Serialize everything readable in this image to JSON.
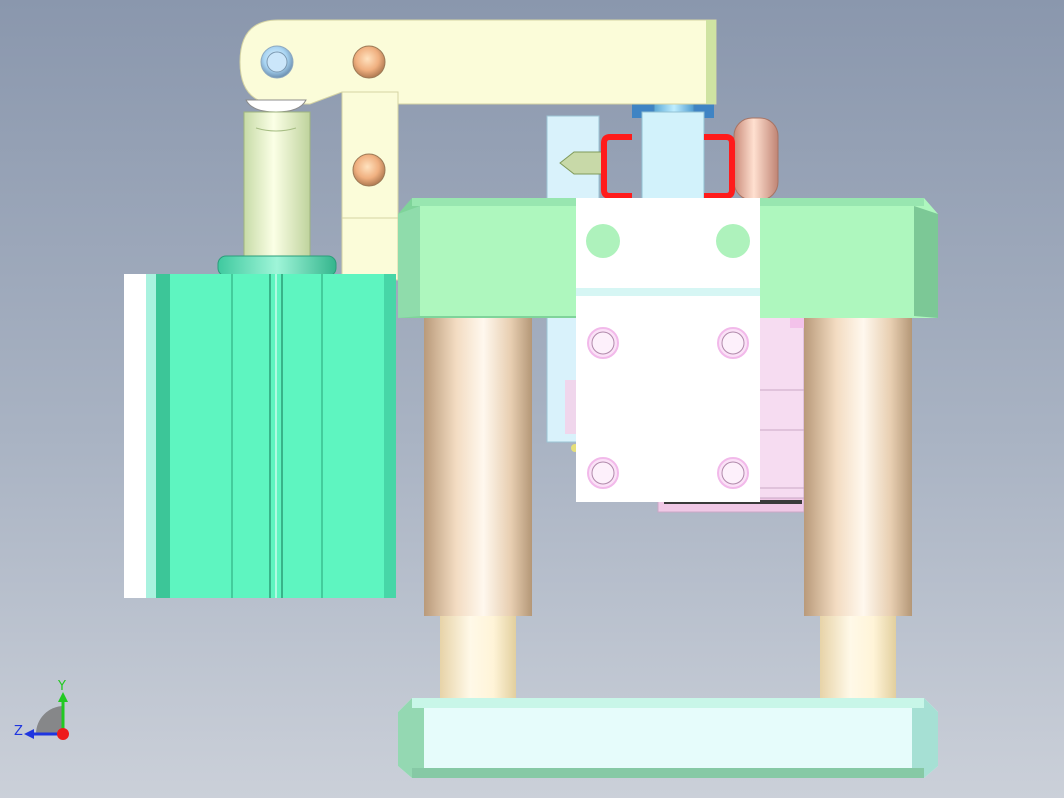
{
  "viewport": {
    "background_top": "#8a97ad",
    "background_bottom": "#cbd0d9"
  },
  "model": {
    "parts": [
      "top-clamp-arm",
      "vertical-link",
      "cylinder-rod",
      "pneumatic-cylinder",
      "top-plate",
      "guide-pillars",
      "center-block",
      "side-block",
      "locating-pin",
      "clamp-bracket",
      "pink-slide",
      "bottom-base"
    ],
    "colors": {
      "arm": "#fbfcd9",
      "cylinder": "#5ef5c0",
      "top_plate": "#aef7be",
      "pillar": "#d8b99a",
      "center_block": "#ffffff",
      "bracket": "#ff1c1c",
      "pink": "#f3d9ef",
      "base": "#e6fcfb"
    }
  },
  "triad": {
    "x_label": "",
    "y_label": "Y",
    "z_label": "Z",
    "icon": "coordinate-triad-icon",
    "y_color": "#22c922",
    "z_color": "#1f35e0",
    "x_color": "#ee1b1b"
  }
}
